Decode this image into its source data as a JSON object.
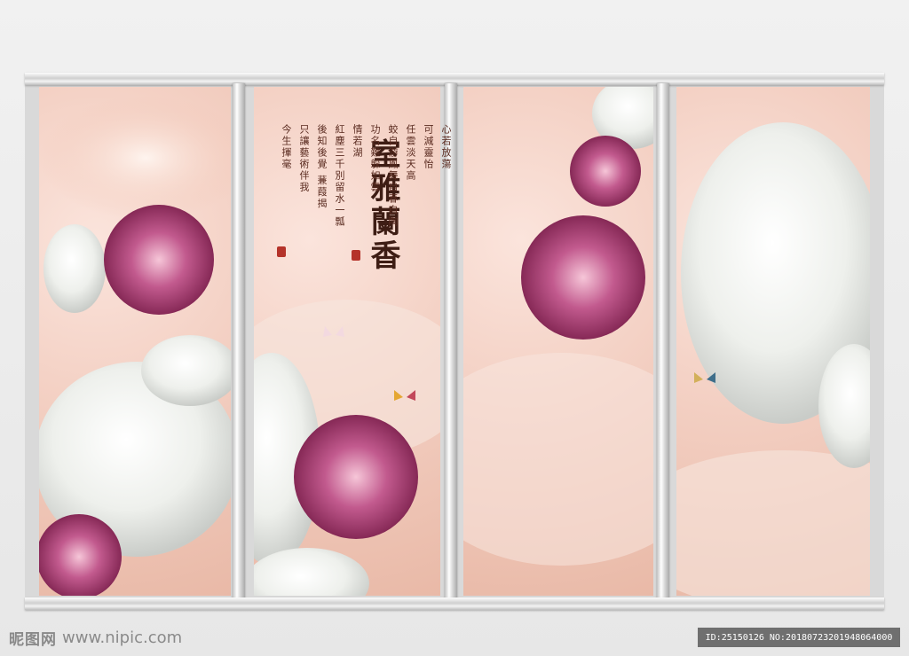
{
  "artwork": {
    "title": "室雅蘭香",
    "poem_columns": [
      "心若放蕩",
      "任雲淡天高",
      "功名難躲如雲",
      "紅塵三千別留水一瓢",
      "後知後覺 蒹葭揭",
      "只讓藝術伴我",
      "可減靈怡",
      "蛟自游鳳舞自春自陶",
      "情若湖",
      "今生揮毫"
    ]
  },
  "watermark": {
    "logo": "昵图网",
    "url": "www.nipic.com"
  },
  "id_label": "ID:25150126 NO:20180723201948064000",
  "colors": {
    "frame": "#d9d9d9",
    "jade_white": "#f4f1ea",
    "flower_pink": "#b6457c",
    "background_peach": "#f3cfc2"
  }
}
